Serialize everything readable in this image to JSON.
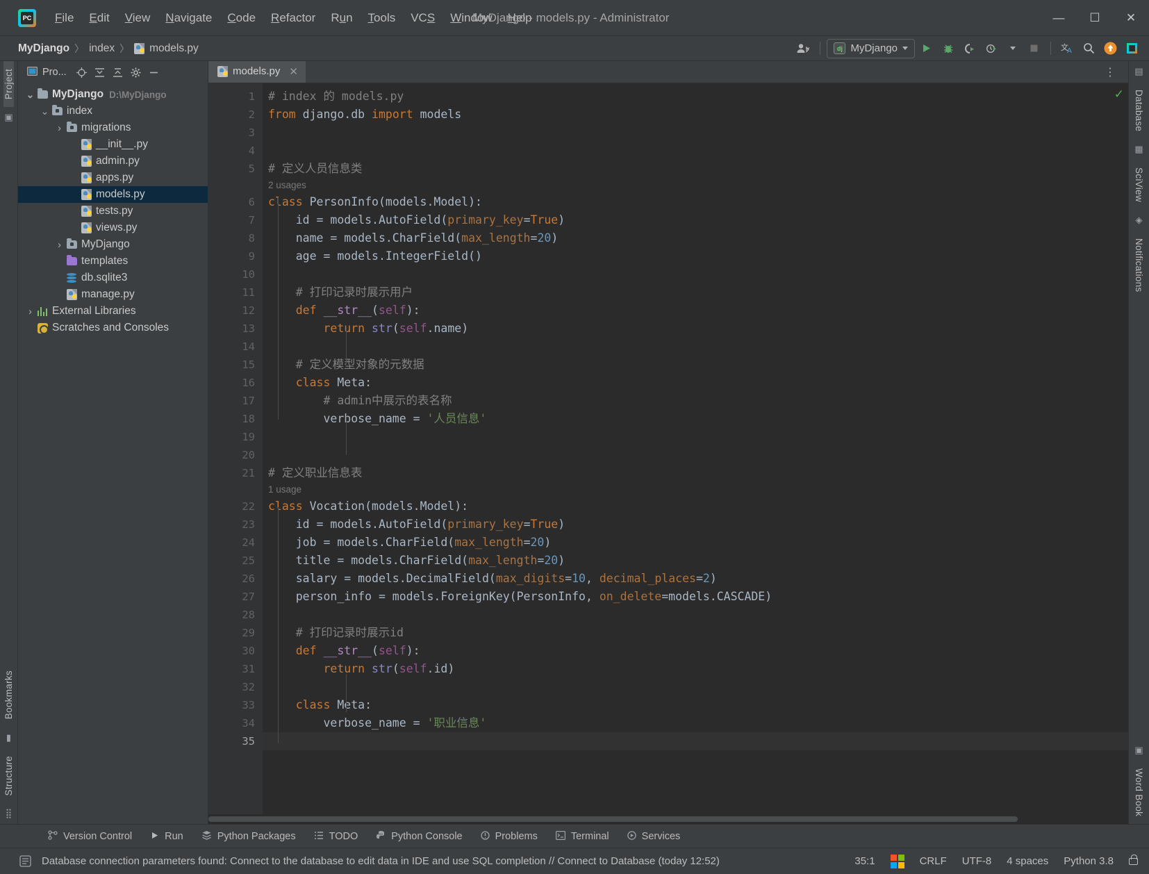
{
  "titlebar": {
    "logo_text": "PC",
    "menus": [
      {
        "label": "File",
        "accel": "F"
      },
      {
        "label": "Edit",
        "accel": "E"
      },
      {
        "label": "View",
        "accel": "V"
      },
      {
        "label": "Navigate",
        "accel": "N"
      },
      {
        "label": "Code",
        "accel": "C"
      },
      {
        "label": "Refactor",
        "accel": "R"
      },
      {
        "label": "Run",
        "accel": "u"
      },
      {
        "label": "Tools",
        "accel": "T"
      },
      {
        "label": "VCS",
        "accel": "S"
      },
      {
        "label": "Window",
        "accel": "W"
      },
      {
        "label": "Help",
        "accel": "H"
      }
    ],
    "window_title": "MyDjango - models.py - Administrator",
    "minimize": "—",
    "maximize": "☐",
    "close": "✕"
  },
  "navbar": {
    "breadcrumbs": [
      "MyDjango",
      "index",
      "models.py"
    ],
    "separator": "〉",
    "run_config": "MyDjango",
    "run_config_badge": "dj",
    "buttons": [
      "run-button",
      "debug-button",
      "run-coverage-button",
      "profile-button",
      "stop-button",
      "translate-button",
      "search-button",
      "updates-button",
      "ide-button"
    ]
  },
  "project_panel": {
    "title": "Pro...",
    "header_buttons": [
      "locate-icon",
      "expand-all-icon",
      "collapse-all-icon",
      "settings-icon",
      "hide-icon"
    ],
    "tree": [
      {
        "label": "MyDjango",
        "path": "D:\\MyDjango",
        "depth": 0,
        "arrow": "⌄",
        "icon": "folder",
        "bold": true,
        "selected": false
      },
      {
        "label": "index",
        "path": "",
        "depth": 1,
        "arrow": "⌄",
        "icon": "folder-src",
        "bold": false,
        "selected": false
      },
      {
        "label": "migrations",
        "path": "",
        "depth": 2,
        "arrow": "›",
        "icon": "folder-src",
        "bold": false,
        "selected": false
      },
      {
        "label": "__init__.py",
        "path": "",
        "depth": 3,
        "arrow": "",
        "icon": "py",
        "bold": false,
        "selected": false
      },
      {
        "label": "admin.py",
        "path": "",
        "depth": 3,
        "arrow": "",
        "icon": "py",
        "bold": false,
        "selected": false
      },
      {
        "label": "apps.py",
        "path": "",
        "depth": 3,
        "arrow": "",
        "icon": "py",
        "bold": false,
        "selected": false
      },
      {
        "label": "models.py",
        "path": "",
        "depth": 3,
        "arrow": "",
        "icon": "py",
        "bold": false,
        "selected": true
      },
      {
        "label": "tests.py",
        "path": "",
        "depth": 3,
        "arrow": "",
        "icon": "py",
        "bold": false,
        "selected": false
      },
      {
        "label": "views.py",
        "path": "",
        "depth": 3,
        "arrow": "",
        "icon": "py",
        "bold": false,
        "selected": false
      },
      {
        "label": "MyDjango",
        "path": "",
        "depth": 2,
        "arrow": "›",
        "icon": "folder-src",
        "bold": false,
        "selected": false
      },
      {
        "label": "templates",
        "path": "",
        "depth": 2,
        "arrow": "",
        "icon": "folder-tpl",
        "bold": false,
        "selected": false
      },
      {
        "label": "db.sqlite3",
        "path": "",
        "depth": 2,
        "arrow": "",
        "icon": "db",
        "bold": false,
        "selected": false
      },
      {
        "label": "manage.py",
        "path": "",
        "depth": 2,
        "arrow": "",
        "icon": "py",
        "bold": false,
        "selected": false
      },
      {
        "label": "External Libraries",
        "path": "",
        "depth": 0,
        "arrow": "›",
        "icon": "lib",
        "bold": false,
        "selected": false
      },
      {
        "label": "Scratches and Consoles",
        "path": "",
        "depth": 0,
        "arrow": "",
        "icon": "scratch",
        "bold": false,
        "selected": false
      }
    ]
  },
  "left_strip": {
    "top_label": "Project",
    "bottom_labels": [
      "Bookmarks",
      "Structure"
    ]
  },
  "right_strip": {
    "labels": [
      "Database",
      "SciView",
      "Notifications",
      "Word Book"
    ]
  },
  "editor": {
    "tabs": [
      {
        "label": "models.py",
        "icon": "py",
        "close": "✕",
        "active": true
      }
    ],
    "inspection_status": "✓",
    "lines": [
      {
        "n": 1,
        "type": "code",
        "tokens": [
          {
            "t": "# index 的 models.py",
            "c": "cmt"
          }
        ],
        "indent": 0
      },
      {
        "n": 2,
        "type": "code",
        "tokens": [
          {
            "t": "from",
            "c": "kw"
          },
          {
            "t": " django.db ",
            "c": ""
          },
          {
            "t": "import",
            "c": "kw"
          },
          {
            "t": " models",
            "c": ""
          }
        ],
        "indent": 0
      },
      {
        "n": 3,
        "type": "code",
        "tokens": [],
        "indent": 0
      },
      {
        "n": 4,
        "type": "code",
        "tokens": [],
        "indent": 0
      },
      {
        "n": 5,
        "type": "code",
        "tokens": [
          {
            "t": "# 定义人员信息类",
            "c": "cmt"
          }
        ],
        "indent": 0
      },
      {
        "n": null,
        "type": "hint",
        "text": "2 usages"
      },
      {
        "n": 6,
        "type": "code",
        "fold": "⊟",
        "tokens": [
          {
            "t": "class",
            "c": "kw"
          },
          {
            "t": " ",
            "c": ""
          },
          {
            "t": "PersonInfo",
            "c": "cls"
          },
          {
            "t": "(models.Model):",
            "c": ""
          }
        ],
        "indent": 0
      },
      {
        "n": 7,
        "type": "code",
        "tokens": [
          {
            "t": "    id = models.AutoField(",
            "c": ""
          },
          {
            "t": "primary_key",
            "c": "kwarg"
          },
          {
            "t": "=",
            "c": ""
          },
          {
            "t": "True",
            "c": "kw"
          },
          {
            "t": ")",
            "c": ""
          }
        ],
        "indent": 1
      },
      {
        "n": 8,
        "type": "code",
        "tokens": [
          {
            "t": "    name = models.CharField(",
            "c": ""
          },
          {
            "t": "max_length",
            "c": "kwarg"
          },
          {
            "t": "=",
            "c": ""
          },
          {
            "t": "20",
            "c": "num"
          },
          {
            "t": ")",
            "c": ""
          }
        ],
        "indent": 1
      },
      {
        "n": 9,
        "type": "code",
        "tokens": [
          {
            "t": "    age = models.IntegerField()",
            "c": ""
          }
        ],
        "indent": 1
      },
      {
        "n": 10,
        "type": "code",
        "tokens": [],
        "indent": 1
      },
      {
        "n": 11,
        "type": "code",
        "tokens": [
          {
            "t": "    ",
            "c": ""
          },
          {
            "t": "# 打印记录时展示用户",
            "c": "cmt"
          }
        ],
        "indent": 1
      },
      {
        "n": 12,
        "type": "code",
        "gmark": "override",
        "fold": "⊟",
        "tokens": [
          {
            "t": "    ",
            "c": ""
          },
          {
            "t": "def",
            "c": "kw"
          },
          {
            "t": " ",
            "c": ""
          },
          {
            "t": "__str__",
            "c": "dunder"
          },
          {
            "t": "(",
            "c": ""
          },
          {
            "t": "self",
            "c": "self"
          },
          {
            "t": "):",
            "c": ""
          }
        ],
        "indent": 1
      },
      {
        "n": 13,
        "type": "code",
        "fold": "⌂",
        "tokens": [
          {
            "t": "        ",
            "c": ""
          },
          {
            "t": "return",
            "c": "kw"
          },
          {
            "t": " ",
            "c": ""
          },
          {
            "t": "str",
            "c": "builtin"
          },
          {
            "t": "(",
            "c": ""
          },
          {
            "t": "self",
            "c": "self"
          },
          {
            "t": ".name)",
            "c": ""
          }
        ],
        "indent": 2
      },
      {
        "n": 14,
        "type": "code",
        "tokens": [],
        "indent": 1
      },
      {
        "n": 15,
        "type": "code",
        "tokens": [
          {
            "t": "    ",
            "c": ""
          },
          {
            "t": "# 定义模型对象的元数据",
            "c": "cmt"
          }
        ],
        "indent": 1
      },
      {
        "n": 16,
        "type": "code",
        "fold": "⊟",
        "tokens": [
          {
            "t": "    ",
            "c": ""
          },
          {
            "t": "class",
            "c": "kw"
          },
          {
            "t": " ",
            "c": ""
          },
          {
            "t": "Meta",
            "c": "cls"
          },
          {
            "t": ":",
            "c": ""
          }
        ],
        "indent": 1
      },
      {
        "n": 17,
        "type": "code",
        "tokens": [
          {
            "t": "        ",
            "c": ""
          },
          {
            "t": "# admin中展示的表名称",
            "c": "cmt"
          }
        ],
        "indent": 2
      },
      {
        "n": 18,
        "type": "code",
        "fold": "⌂",
        "tokens": [
          {
            "t": "        verbose_name = ",
            "c": ""
          },
          {
            "t": "'人员信息'",
            "c": "str"
          }
        ],
        "indent": 2
      },
      {
        "n": 19,
        "type": "code",
        "tokens": [],
        "indent": 0
      },
      {
        "n": 20,
        "type": "code",
        "tokens": [],
        "indent": 0
      },
      {
        "n": 21,
        "type": "code",
        "tokens": [
          {
            "t": "# 定义职业信息表",
            "c": "cmt"
          }
        ],
        "indent": 0
      },
      {
        "n": null,
        "type": "hint",
        "text": "1 usage"
      },
      {
        "n": 22,
        "type": "code",
        "fold": "⊟",
        "tokens": [
          {
            "t": "class",
            "c": "kw"
          },
          {
            "t": " ",
            "c": ""
          },
          {
            "t": "Vocation",
            "c": "cls"
          },
          {
            "t": "(models.Model):",
            "c": ""
          }
        ],
        "indent": 0
      },
      {
        "n": 23,
        "type": "code",
        "tokens": [
          {
            "t": "    id = models.AutoField(",
            "c": ""
          },
          {
            "t": "primary_key",
            "c": "kwarg"
          },
          {
            "t": "=",
            "c": ""
          },
          {
            "t": "True",
            "c": "kw"
          },
          {
            "t": ")",
            "c": ""
          }
        ],
        "indent": 1
      },
      {
        "n": 24,
        "type": "code",
        "tokens": [
          {
            "t": "    job = models.CharField(",
            "c": ""
          },
          {
            "t": "max_length",
            "c": "kwarg"
          },
          {
            "t": "=",
            "c": ""
          },
          {
            "t": "20",
            "c": "num"
          },
          {
            "t": ")",
            "c": ""
          }
        ],
        "indent": 1
      },
      {
        "n": 25,
        "type": "code",
        "tokens": [
          {
            "t": "    title = models.CharField(",
            "c": ""
          },
          {
            "t": "max_length",
            "c": "kwarg"
          },
          {
            "t": "=",
            "c": ""
          },
          {
            "t": "20",
            "c": "num"
          },
          {
            "t": ")",
            "c": ""
          }
        ],
        "indent": 1
      },
      {
        "n": 26,
        "type": "code",
        "tokens": [
          {
            "t": "    salary = models.DecimalField(",
            "c": ""
          },
          {
            "t": "max_digits",
            "c": "kwarg"
          },
          {
            "t": "=",
            "c": ""
          },
          {
            "t": "10",
            "c": "num"
          },
          {
            "t": ", ",
            "c": ""
          },
          {
            "t": "decimal_places",
            "c": "kwarg"
          },
          {
            "t": "=",
            "c": ""
          },
          {
            "t": "2",
            "c": "num"
          },
          {
            "t": ")",
            "c": ""
          }
        ],
        "indent": 1
      },
      {
        "n": 27,
        "type": "code",
        "tokens": [
          {
            "t": "    person_info = models.ForeignKey(PersonInfo, ",
            "c": ""
          },
          {
            "t": "on_delete",
            "c": "kwarg"
          },
          {
            "t": "=models.CASCADE)",
            "c": ""
          }
        ],
        "indent": 1
      },
      {
        "n": 28,
        "type": "code",
        "tokens": [],
        "indent": 1
      },
      {
        "n": 29,
        "type": "code",
        "tokens": [
          {
            "t": "    ",
            "c": ""
          },
          {
            "t": "# 打印记录时展示id",
            "c": "cmt"
          }
        ],
        "indent": 1
      },
      {
        "n": 30,
        "type": "code",
        "gmark": "override",
        "fold": "⊟",
        "tokens": [
          {
            "t": "    ",
            "c": ""
          },
          {
            "t": "def",
            "c": "kw"
          },
          {
            "t": " ",
            "c": ""
          },
          {
            "t": "__str__",
            "c": "dunder"
          },
          {
            "t": "(",
            "c": ""
          },
          {
            "t": "self",
            "c": "self"
          },
          {
            "t": "):",
            "c": ""
          }
        ],
        "indent": 1
      },
      {
        "n": 31,
        "type": "code",
        "fold": "⌂",
        "tokens": [
          {
            "t": "        ",
            "c": ""
          },
          {
            "t": "return",
            "c": "kw"
          },
          {
            "t": " ",
            "c": ""
          },
          {
            "t": "str",
            "c": "builtin"
          },
          {
            "t": "(",
            "c": ""
          },
          {
            "t": "self",
            "c": "self"
          },
          {
            "t": ".id)",
            "c": ""
          }
        ],
        "indent": 2
      },
      {
        "n": 32,
        "type": "code",
        "tokens": [],
        "indent": 1
      },
      {
        "n": 33,
        "type": "code",
        "fold": "⊟",
        "tokens": [
          {
            "t": "    ",
            "c": ""
          },
          {
            "t": "class",
            "c": "kw"
          },
          {
            "t": " ",
            "c": ""
          },
          {
            "t": "Meta",
            "c": "cls"
          },
          {
            "t": ":",
            "c": ""
          }
        ],
        "indent": 1
      },
      {
        "n": 34,
        "type": "code",
        "fold": "⌂",
        "tokens": [
          {
            "t": "        verbose_name = ",
            "c": ""
          },
          {
            "t": "'职业信息'",
            "c": "str"
          }
        ],
        "indent": 2
      },
      {
        "n": 35,
        "type": "code",
        "current": true,
        "tokens": [],
        "indent": 0
      }
    ]
  },
  "toolwindows": [
    {
      "label": "Version Control",
      "icon": "branch-icon"
    },
    {
      "label": "Run",
      "icon": "play-icon"
    },
    {
      "label": "Python Packages",
      "icon": "packages-icon"
    },
    {
      "label": "TODO",
      "icon": "list-icon"
    },
    {
      "label": "Python Console",
      "icon": "python-icon"
    },
    {
      "label": "Problems",
      "icon": "warning-icon"
    },
    {
      "label": "Terminal",
      "icon": "terminal-icon"
    },
    {
      "label": "Services",
      "icon": "services-icon"
    }
  ],
  "statusbar": {
    "message": "Database connection parameters found: Connect to the database to edit data in IDE and use SQL completion // Connect to Database (today 12:52)",
    "caret": "35:1",
    "line_separator": "CRLF",
    "encoding": "UTF-8",
    "indent": "4 spaces",
    "interpreter": "Python 3.8"
  },
  "colors": {
    "bg_editor": "#2b2b2b",
    "bg_panel": "#3c3f41",
    "gutter": "#313335",
    "selection": "#0d293e",
    "keyword": "#cc7832",
    "string": "#6a8759",
    "number": "#6897bb",
    "comment": "#808080",
    "text": "#a9b7c6",
    "accent_green": "#4fb34f"
  }
}
